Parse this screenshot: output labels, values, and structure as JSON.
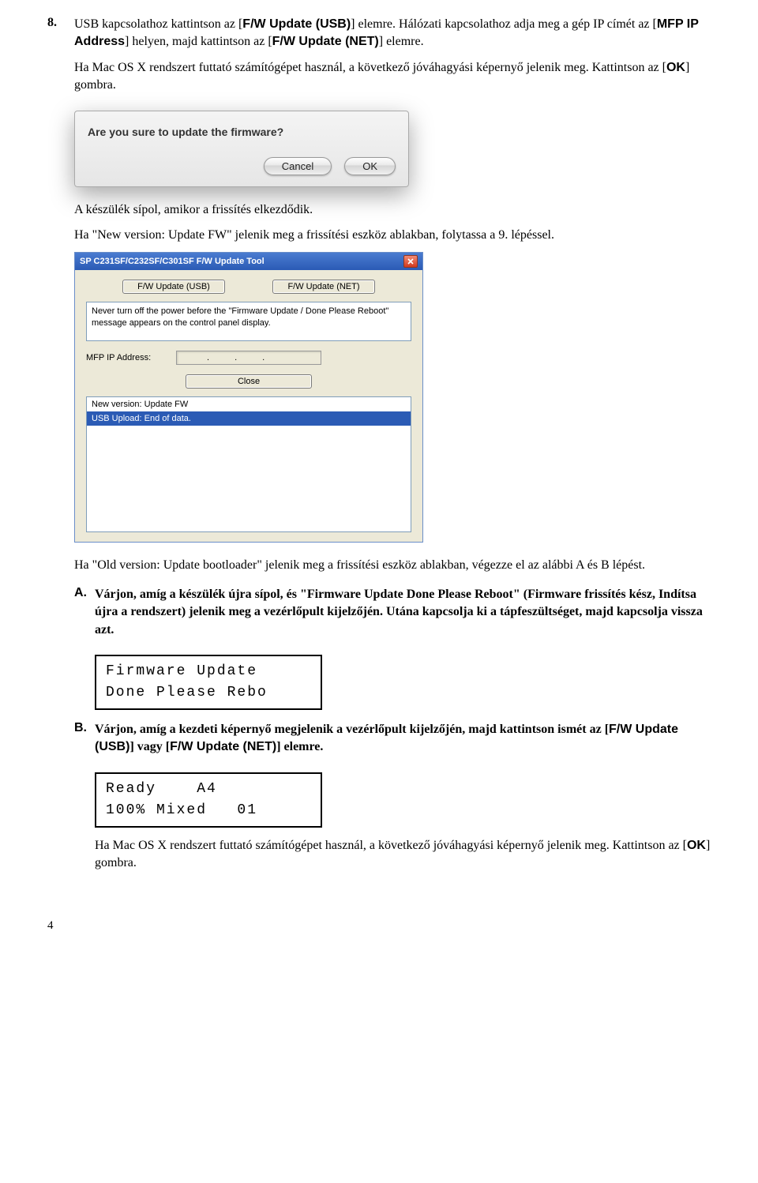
{
  "step": {
    "num": "8.",
    "p1_a": "USB kapcsolathoz kattintson az [",
    "p1_b": "F/W Update (USB)",
    "p1_c": "] elemre. Hálózati kapcsolathoz adja meg a gép IP címét az [",
    "p1_d": "MFP IP Address",
    "p1_e": "] helyen, majd kattintson az [",
    "p1_f": "F/W Update (NET)",
    "p1_g": "] elemre.",
    "p2_a": "Ha Mac OS X rendszert futtató számítógépet használ, a következő jóváhagyási képernyő jelenik meg. Kattintson az [",
    "p2_b": "OK",
    "p2_c": "] gombra."
  },
  "macDialog": {
    "msg": "Are you sure to update the firmware?",
    "cancel": "Cancel",
    "ok": "OK"
  },
  "mid": {
    "p1": "A készülék sípol, amikor a frissítés elkezdődik.",
    "p2": "Ha \"New version: Update FW\" jelenik meg a frissítési eszköz ablakban, folytassa a 9. lépéssel."
  },
  "win": {
    "title": "SP C231SF/C232SF/C301SF F/W Update Tool",
    "btnUSB": "F/W Update (USB)",
    "btnNET": "F/W Update (NET)",
    "note": "Never turn off the power before the \"Firmware Update / Done Please Reboot\" message appears on the control panel display.",
    "ipLabel": "MFP IP Address:",
    "dots": ".",
    "close": "Close",
    "status1": "New version: Update FW",
    "status2": "USB Upload: End of data."
  },
  "after": {
    "p1": "Ha \"Old version: Update bootloader\" jelenik meg a frissítési eszköz ablakban, végezze el az alábbi A és B lépést."
  },
  "subA": {
    "letter": "A.",
    "t1": "Várjon, amíg a készülék újra sípol, és \"Firmware Update Done Please Reboot\" (Firmware frissítés kész, Indítsa újra a rendszert) jelenik meg a vezérlőpult kijelzőjén. Utána kapcsolja ki a tápfeszültséget, majd kapcsolja vissza azt.",
    "lcd": "Firmware Update\nDone Please Rebo"
  },
  "subB": {
    "letter": "B.",
    "t1_a": "Várjon, amíg a kezdeti képernyő megjelenik a vezérlőpult kijelzőjén, majd kattintson ismét az [",
    "t1_b": "F/W Update (USB)",
    "t1_c": "] vagy [",
    "t1_d": "F/W Update (NET)",
    "t1_e": "] elemre.",
    "lcd": "Ready    A4\n100% Mixed   01",
    "t2_a": "Ha Mac OS X rendszert futtató számítógépet használ, a következő jóváhagyási képernyő jelenik meg. Kattintson az [",
    "t2_b": "OK",
    "t2_c": "] gombra."
  },
  "pagenum": "4"
}
